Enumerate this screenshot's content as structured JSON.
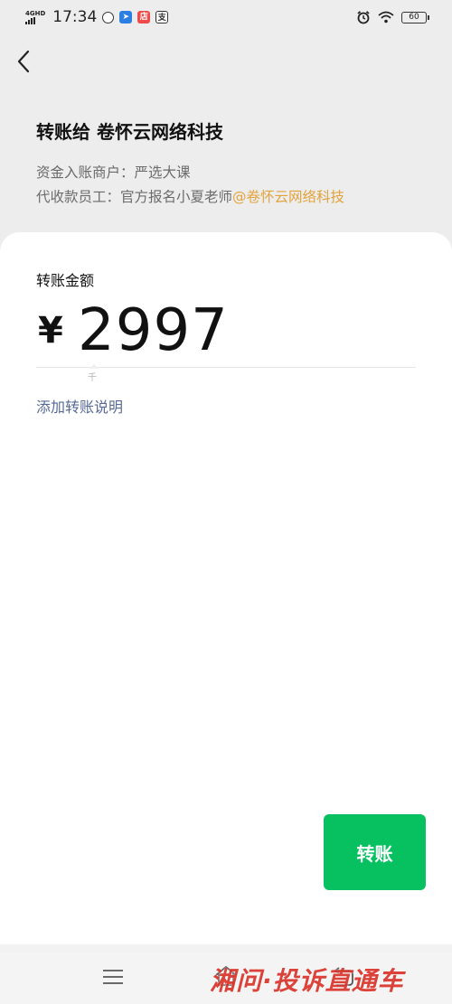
{
  "status_bar": {
    "network": "4GHD",
    "time": "17:34",
    "battery": "60",
    "app_icons": [
      "vpn-icon",
      "maps-icon",
      "shopping-icon",
      "notification-icon"
    ]
  },
  "header": {
    "back_icon": "chevron-left-icon",
    "title": "转账给 卷怀云网络科技",
    "merchant_label": "资金入账商户：",
    "merchant_name": "严选大课",
    "collector_label": "代收款员工：",
    "collector_name": "官方报名小夏老师",
    "collector_org": "@卷怀云网络科技"
  },
  "amount": {
    "label": "转账金额",
    "currency_symbol": "¥",
    "value": "2997",
    "unit_hint": "千"
  },
  "add_note_label": "添加转账说明",
  "transfer_button_label": "转账",
  "watermark": "湘问·投诉直通车",
  "colors": {
    "background": "#ededed",
    "card": "#ffffff",
    "accent_green": "#07c160",
    "link_blue": "#576b95",
    "link_orange": "#e2a33c"
  }
}
